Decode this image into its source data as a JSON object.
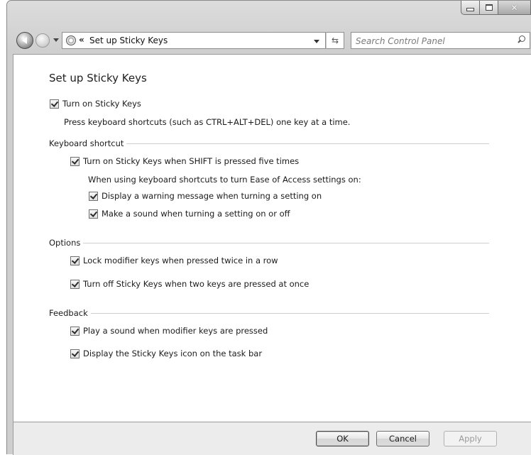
{
  "window": {
    "caption": {
      "minimize_icon": "minimize-icon",
      "maximize_icon": "maximize-icon",
      "close_glyph": "✕"
    }
  },
  "nav": {
    "address_chevron": "«",
    "address_text": "Set up Sticky Keys",
    "refresh_glyph": "⁴⁄₄",
    "search_placeholder": "Search Control Panel"
  },
  "page": {
    "title": "Set up Sticky Keys",
    "main_checkbox": {
      "label": "Turn on Sticky Keys",
      "checked": true
    },
    "main_description": "Press keyboard shortcuts (such as CTRL+ALT+DEL) one key at a time.",
    "keyboard_shortcut": {
      "header": "Keyboard shortcut",
      "shift_checkbox": {
        "label": "Turn on Sticky Keys when SHIFT is pressed five times",
        "checked": true
      },
      "sub_description": "When using keyboard shortcuts to turn Ease of Access settings on:",
      "warning_checkbox": {
        "label": "Display a warning message when turning a setting on",
        "checked": true
      },
      "sound_checkbox": {
        "label": "Make a sound when turning a setting on or off",
        "checked": true
      }
    },
    "options": {
      "header": "Options",
      "lock_checkbox": {
        "label": "Lock modifier keys when pressed twice in a row",
        "checked": true
      },
      "turnoff_checkbox": {
        "label": "Turn off Sticky Keys when two keys are pressed at once",
        "checked": true
      }
    },
    "feedback": {
      "header": "Feedback",
      "play_sound_checkbox": {
        "label": "Play a sound when modifier keys are pressed",
        "checked": true
      },
      "taskbar_icon_checkbox": {
        "label": "Display the Sticky Keys icon on the task bar",
        "checked": true
      }
    }
  },
  "footer": {
    "ok_label": "OK",
    "cancel_label": "Cancel",
    "apply_label": "Apply"
  }
}
